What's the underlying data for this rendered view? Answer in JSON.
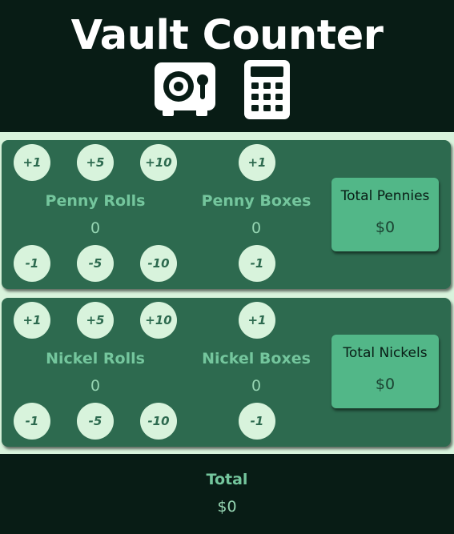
{
  "app": {
    "title": "Vault Counter"
  },
  "header": {
    "icons": [
      "vault-icon",
      "calculator-icon"
    ]
  },
  "pennies": {
    "rolls": {
      "label": "Penny Rolls",
      "count": "0",
      "inc": [
        "+1",
        "+5",
        "+10"
      ],
      "dec": [
        "-1",
        "-5",
        "-10"
      ]
    },
    "boxes": {
      "label": "Penny Boxes",
      "count": "0",
      "inc": [
        "+1"
      ],
      "dec": [
        "-1"
      ]
    },
    "total": {
      "label": "Total Pennies",
      "value": "$0"
    }
  },
  "nickels": {
    "rolls": {
      "label": "Nickel Rolls",
      "count": "0",
      "inc": [
        "+1",
        "+5",
        "+10"
      ],
      "dec": [
        "-1",
        "-5",
        "-10"
      ]
    },
    "boxes": {
      "label": "Nickel Boxes",
      "count": "0",
      "inc": [
        "+1"
      ],
      "dec": [
        "-1"
      ]
    },
    "total": {
      "label": "Total Nickels",
      "value": "$0"
    }
  },
  "footer": {
    "label": "Total",
    "value": "$0"
  },
  "colors": {
    "dark": "#081c15",
    "panel": "#2d6a4f",
    "accent": "#52b788",
    "label": "#74c69d",
    "light": "#d8f3dc"
  }
}
